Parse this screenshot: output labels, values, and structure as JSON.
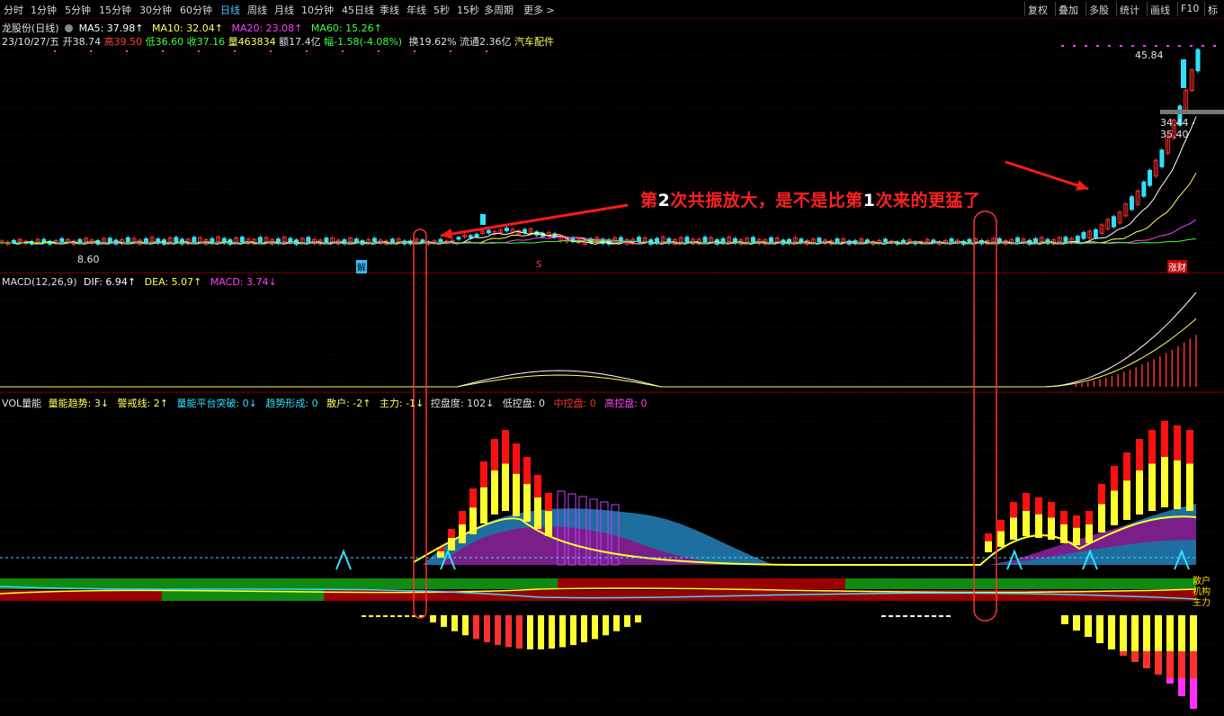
{
  "toolbar": {
    "periods": [
      "分时",
      "1分钟",
      "5分钟",
      "15分钟",
      "30分钟",
      "60分钟",
      "日线",
      "周线",
      "月线",
      "10分钟",
      "45日线",
      "季线",
      "年线",
      "5秒",
      "15秒",
      "多周期",
      "更多 >"
    ],
    "active_period": "日线",
    "right_buttons": [
      "复权",
      "叠加",
      "多股",
      "统计",
      "画线",
      "F10",
      "标"
    ]
  },
  "stock": {
    "title": "龙股份(日线)",
    "ma5": "MA5: 37.98↑",
    "ma10": "MA10: 32.04↑",
    "ma20": "MA20: 23.08↑",
    "ma60": "MA60: 15.26↑",
    "date": "23/10/27/五",
    "open": "开38.74",
    "high": "高39.50",
    "low": "低36.60",
    "close": "收37.16",
    "volume": "量463834",
    "amount": "额17.4亿",
    "change": "幅-1.58(-4.08%)",
    "turnover": "换19.62%",
    "float_cap": "流通2.36亿",
    "sector": "汽车配件"
  },
  "price_labels": {
    "high_mark": "45.84",
    "range_mark": "34.44 - 35.40",
    "low_mark": "8.60",
    "tag_jie": "解",
    "tag_s": "S",
    "tag_zhangcai": "涨财"
  },
  "macd": {
    "label": "MACD(12,26,9)",
    "dif": "DIF: 6.94↑",
    "dea": "DEA: 5.07↑",
    "macd": "MACD: 3.74↓"
  },
  "vol": {
    "label": "VOL量能",
    "trend": "量能趋势: 3↓",
    "warn": "警戒线: 2↑",
    "platform": "量能平台突破: 0↓",
    "form": "趋势形成: 0",
    "retail": "散户: -2↑",
    "main": "主力: -1↓",
    "control": "控盘度: 102↓",
    "low_ctrl": "低控盘: 0",
    "mid_ctrl": "中控盘: 0",
    "high_ctrl": "高控盘: 0",
    "right_labels": [
      "散户",
      "机构",
      "主力"
    ]
  },
  "annotation": {
    "text_a": "第",
    "n2": "2",
    "text_b": "次共振放大，是不是比第",
    "n1": "1",
    "text_c": "次来的更猛了"
  },
  "colors": {
    "up": "#ff3030",
    "down": "#30e0ff",
    "ma5": "#ffffff",
    "ma10": "#ffff60",
    "ma20": "#ff40ff",
    "ma60": "#40ff40",
    "active_tab": "#4fc3ff"
  }
}
